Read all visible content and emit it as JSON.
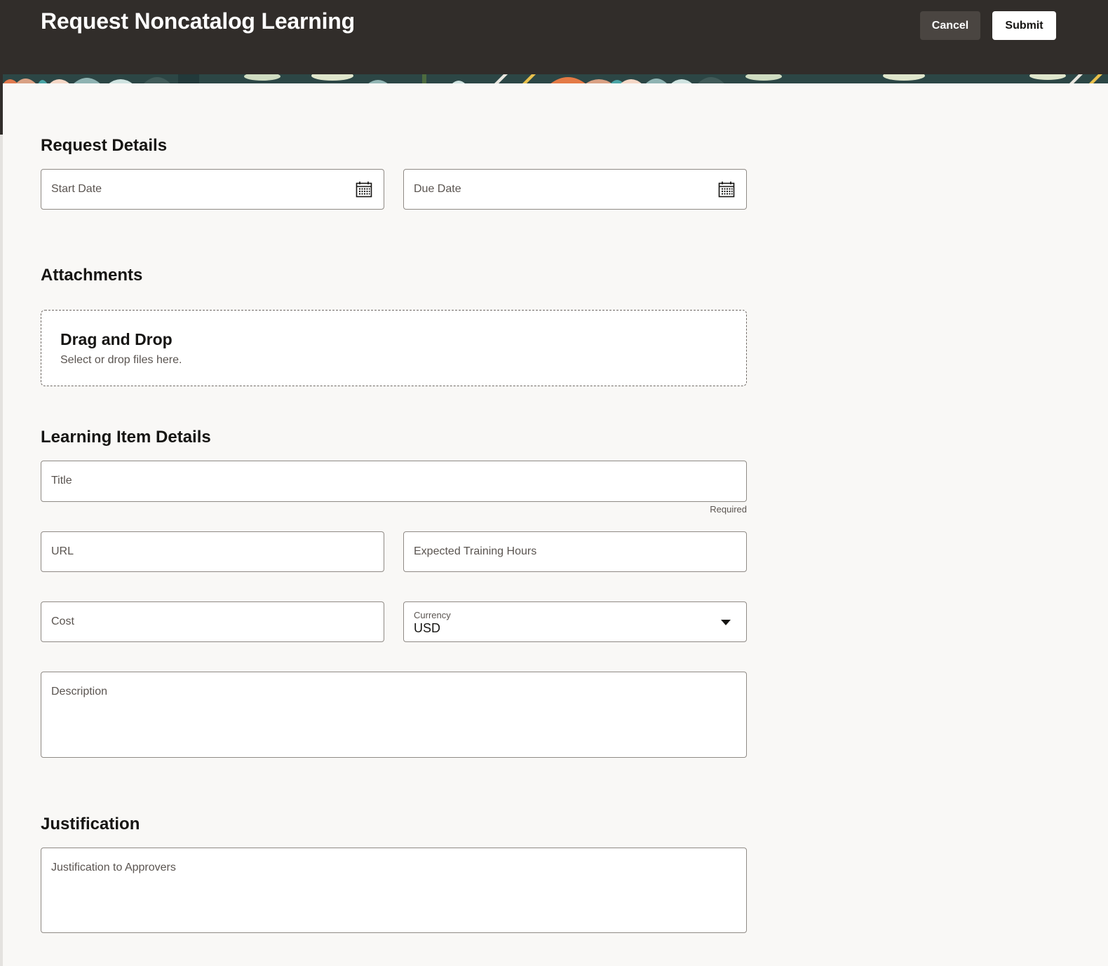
{
  "header": {
    "title": "Request Noncatalog Learning",
    "cancel_label": "Cancel",
    "submit_label": "Submit"
  },
  "sections": {
    "request_details": {
      "title": "Request Details",
      "start_date_label": "Start Date",
      "due_date_label": "Due Date",
      "date_icon": "calendar-icon"
    },
    "attachments": {
      "title": "Attachments",
      "dropzone_title": "Drag and Drop",
      "dropzone_subtitle": "Select or drop files here."
    },
    "learning_item": {
      "title": "Learning Item Details",
      "title_field_label": "Title",
      "title_required_text": "Required",
      "url_label": "URL",
      "hours_label": "Expected Training Hours",
      "cost_label": "Cost",
      "currency_label": "Currency",
      "currency_value": "USD",
      "currency_icon": "chevron-down-icon",
      "description_label": "Description"
    },
    "justification": {
      "title": "Justification",
      "field_label": "Justification to Approvers"
    }
  },
  "colors": {
    "header_bg": "#312d2a",
    "page_bg": "#f9f8f6",
    "field_border": "#8f8a85",
    "label_text": "#5a5450"
  }
}
